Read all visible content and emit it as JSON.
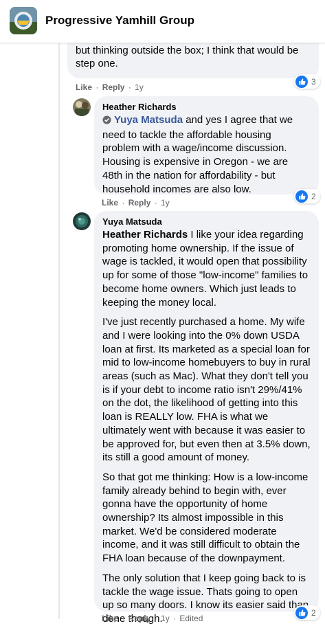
{
  "header": {
    "group_name": "Progressive Yamhill Group"
  },
  "comment1": {
    "text": "know that opens up a whole other can of worms, but thinking outside the box; I think that would be step one.",
    "like": "Like",
    "reply": "Reply",
    "age": "1y",
    "reaction_count": "3"
  },
  "comment2": {
    "author": "Heather Richards",
    "mention": "Yuya Matsuda",
    "text": " and yes I agree that we need to tackle the affordable housing problem with a wage/income discussion. Housing is expensive in Oregon - we are 48th in the nation for affordability - but household incomes are also low.",
    "like": "Like",
    "reply": "Reply",
    "age": "1y",
    "reaction_count": "2"
  },
  "comment3": {
    "author": "Yuya Matsuda",
    "mention": "Heather Richards",
    "para1": " I like your idea regarding promoting home ownership. If the issue of wage is tackled, it would open that possibility up for some of those \"low-income\" families to become home owners. Which just leads to keeping the money local.",
    "para2": "I've just recently purchased a home. My wife and I were looking into the 0% down USDA loan at first. Its marketed as a special loan for mid to low-income homebuyers to buy in rural areas (such as Mac). What they don't tell you is if your debt to income ratio isn't 29%/41% on the dot, the likelihood of getting into this loan is REALLY low. FHA is what we ultimately went with because it was easier to be approved for, but even then at 3.5% down, its still a good amount of money.",
    "para3": "So that got me thinking: How is a low-income family already behind to begin with, ever gonna have the opportunity of home ownership? Its almost impossible in this market. We'd be considered moderate income, and it was still difficult to obtain the FHA loan because of the downpayment.",
    "para4": "The only solution that I keep going back to is tackle the wage issue. Thats going to open up so many doors. I know its easier said than done though.",
    "like": "Like",
    "reply": "Reply",
    "age": "1y",
    "edited": "Edited",
    "reaction_count": "2"
  },
  "colors": {
    "like_blue": "#1877f2",
    "bubble_bg": "#f0f2f5",
    "meta_gray": "#65676b"
  },
  "icons": {
    "reaction": "like-thumb-icon",
    "mention_tag": "check-badge-icon"
  }
}
